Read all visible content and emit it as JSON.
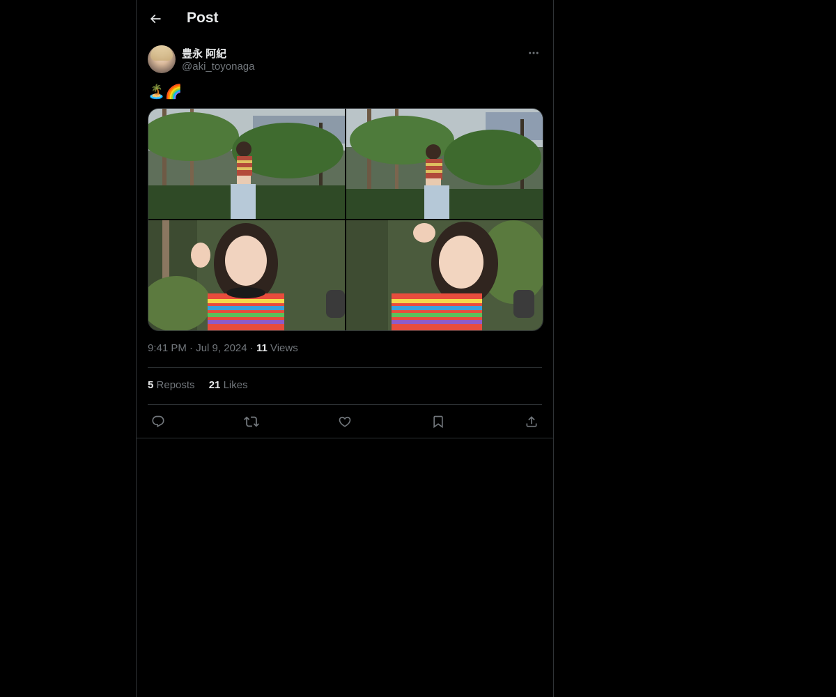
{
  "header": {
    "title": "Post",
    "back_icon": "arrow-left-icon"
  },
  "author": {
    "display_name": "豊永 阿紀",
    "handle": "@aki_toyonaga",
    "more_icon": "more-horizontal-icon"
  },
  "post": {
    "text": "🏝️🌈",
    "media_count": 4,
    "time": "9:41 PM",
    "date": "Jul 9, 2024",
    "views_count": "11",
    "views_label": "Views"
  },
  "stats": {
    "reposts_count": "5",
    "reposts_label": "Reposts",
    "likes_count": "21",
    "likes_label": "Likes"
  },
  "actions": [
    {
      "name": "reply",
      "icon": "reply-icon"
    },
    {
      "name": "repost",
      "icon": "repost-icon"
    },
    {
      "name": "like",
      "icon": "heart-icon"
    },
    {
      "name": "bookmark",
      "icon": "bookmark-icon"
    },
    {
      "name": "share",
      "icon": "share-icon"
    }
  ],
  "colors": {
    "background": "#000000",
    "border": "#2f3336",
    "primary_text": "#e7e9ea",
    "secondary_text": "#71767b"
  }
}
